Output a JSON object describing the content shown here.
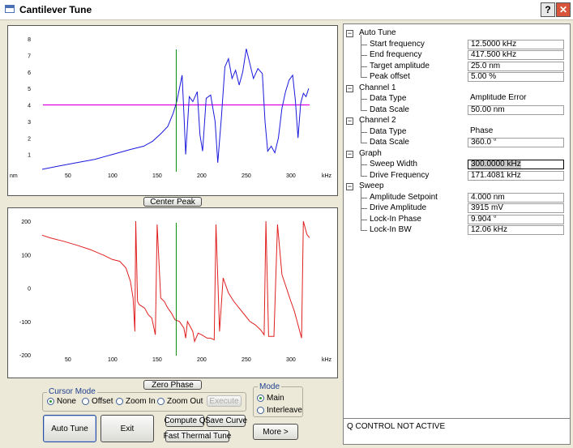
{
  "window": {
    "title": "Cantilever Tune",
    "help_label": "?",
    "close_label": "✕"
  },
  "buttons": {
    "center_peak": "Center Peak",
    "zero_phase": "Zero Phase",
    "execute": "Execute",
    "auto_tune": "Auto Tune",
    "exit": "Exit",
    "compute_q": "Compute Q",
    "save_curve": "Save Curve",
    "fast_thermal_tune": "Fast Thermal Tune",
    "more": "More >"
  },
  "cursor_mode": {
    "label": "Cursor Mode",
    "options": [
      "None",
      "Offset",
      "Zoom In",
      "Zoom Out"
    ],
    "selected": "None"
  },
  "mode": {
    "label": "Mode",
    "options": [
      "Main",
      "Interleave"
    ],
    "selected": "Main"
  },
  "settings": {
    "sections": [
      {
        "name": "Auto Tune",
        "items": [
          {
            "label": "Start frequency",
            "value": "12.5000 kHz",
            "boxed": true
          },
          {
            "label": "End frequency",
            "value": "417.500 kHz",
            "boxed": true
          },
          {
            "label": "Target amplitude",
            "value": "25.0 nm",
            "boxed": true
          },
          {
            "label": "Peak offset",
            "value": "5.00 %",
            "boxed": true
          }
        ]
      },
      {
        "name": "Channel 1",
        "items": [
          {
            "label": "Data Type",
            "value": "Amplitude Error",
            "boxed": false
          },
          {
            "label": "Data Scale",
            "value": "50.00 nm",
            "boxed": true
          }
        ]
      },
      {
        "name": "Channel 2",
        "items": [
          {
            "label": "Data Type",
            "value": "Phase",
            "boxed": false
          },
          {
            "label": "Data Scale",
            "value": "360.0 °",
            "boxed": true
          }
        ]
      },
      {
        "name": "Graph",
        "items": [
          {
            "label": "Sweep Width",
            "value": "300.0000 kHz",
            "boxed": true,
            "selected": true
          },
          {
            "label": "Drive Frequency",
            "value": "171.4081 kHz",
            "boxed": true
          }
        ]
      },
      {
        "name": "Sweep",
        "items": [
          {
            "label": "Amplitude Setpoint",
            "value": "4.000 nm",
            "boxed": true
          },
          {
            "label": "Drive Amplitude",
            "value": "3915 mV",
            "boxed": true
          },
          {
            "label": "Lock-In Phase",
            "value": "9.904 °",
            "boxed": true
          },
          {
            "label": "Lock-In BW",
            "value": "12.06 kHz",
            "boxed": true
          }
        ]
      }
    ]
  },
  "status": "Q CONTROL NOT ACTIVE",
  "colors": {
    "amplitude_trace": "#1a1adc",
    "phase_trace": "#e02020",
    "setpoint_line": "#e000e0",
    "drive_marker": "#0a8a0a"
  },
  "chart_data": [
    {
      "type": "line",
      "title": "",
      "xlabel": "kHz",
      "ylabel": "nm",
      "xlim": [
        21,
        321
      ],
      "ylim": [
        0,
        8
      ],
      "x_ticks": [
        50,
        100,
        150,
        200,
        250,
        300
      ],
      "y_ticks": [
        1,
        2,
        3,
        4,
        5,
        6,
        7,
        8
      ],
      "series": [
        {
          "values_xy": [
            [
              21,
              0.1
            ],
            [
              40,
              0.3
            ],
            [
              60,
              0.5
            ],
            [
              80,
              0.7
            ],
            [
              100,
              1.0
            ],
            [
              120,
              1.3
            ],
            [
              135,
              1.5
            ],
            [
              145,
              1.8
            ],
            [
              155,
              2.3
            ],
            [
              162,
              2.7
            ],
            [
              168,
              3.5
            ],
            [
              172,
              4.2
            ],
            [
              175,
              5.0
            ],
            [
              178,
              5.8
            ],
            [
              180,
              3.5
            ],
            [
              182,
              1.0
            ],
            [
              186,
              4.5
            ],
            [
              190,
              4.2
            ],
            [
              195,
              4.8
            ],
            [
              198,
              2.2
            ],
            [
              201,
              1.2
            ],
            [
              205,
              4.4
            ],
            [
              210,
              4.6
            ],
            [
              215,
              3.0
            ],
            [
              218,
              0.5
            ],
            [
              222,
              3.2
            ],
            [
              226,
              6.3
            ],
            [
              230,
              6.8
            ],
            [
              234,
              5.6
            ],
            [
              238,
              6.1
            ],
            [
              242,
              5.2
            ],
            [
              246,
              6.0
            ],
            [
              250,
              7.4
            ],
            [
              254,
              6.5
            ],
            [
              258,
              5.6
            ],
            [
              263,
              6.2
            ],
            [
              268,
              5.9
            ],
            [
              271,
              3.0
            ],
            [
              274,
              1.2
            ],
            [
              278,
              1.5
            ],
            [
              282,
              1.1
            ],
            [
              286,
              2.0
            ],
            [
              290,
              3.8
            ],
            [
              294,
              4.8
            ],
            [
              298,
              5.5
            ],
            [
              302,
              5.8
            ],
            [
              305,
              4.3
            ],
            [
              308,
              2.0
            ],
            [
              311,
              4.1
            ],
            [
              314,
              4.7
            ],
            [
              317,
              4.5
            ],
            [
              320,
              5.0
            ]
          ]
        }
      ],
      "setpoint": 4.0,
      "drive_frequency": 171.4
    },
    {
      "type": "line",
      "title": "",
      "xlabel": "kHz",
      "ylabel": "",
      "xlim": [
        21,
        321
      ],
      "ylim": [
        -200,
        200
      ],
      "x_ticks": [
        50,
        100,
        150,
        200,
        250,
        300
      ],
      "y_ticks": [
        200,
        100,
        0,
        -100,
        -200
      ],
      "series": [
        {
          "values_xy": [
            [
              21,
              158
            ],
            [
              30,
              150
            ],
            [
              45,
              140
            ],
            [
              60,
              128
            ],
            [
              75,
              115
            ],
            [
              90,
              98
            ],
            [
              100,
              85
            ],
            [
              108,
              80
            ],
            [
              115,
              60
            ],
            [
              120,
              20
            ],
            [
              123,
              -30
            ],
            [
              125,
              -130
            ],
            [
              126,
              200
            ],
            [
              128,
              -40
            ],
            [
              130,
              -50
            ],
            [
              136,
              -60
            ],
            [
              140,
              -80
            ],
            [
              144,
              -90
            ],
            [
              148,
              -140
            ],
            [
              150,
              190
            ],
            [
              154,
              -30
            ],
            [
              158,
              -40
            ],
            [
              162,
              -60
            ],
            [
              166,
              -75
            ],
            [
              170,
              -95
            ],
            [
              175,
              -100
            ],
            [
              180,
              -120
            ],
            [
              182,
              -150
            ],
            [
              184,
              -100
            ],
            [
              186,
              -110
            ],
            [
              190,
              -130
            ],
            [
              192,
              -160
            ],
            [
              196,
              -135
            ],
            [
              200,
              -140
            ],
            [
              206,
              -150
            ],
            [
              210,
              -150
            ],
            [
              214,
              -155
            ],
            [
              216,
              190
            ],
            [
              220,
              -130
            ],
            [
              224,
              30
            ],
            [
              230,
              -15
            ],
            [
              236,
              -40
            ],
            [
              242,
              -60
            ],
            [
              248,
              -80
            ],
            [
              254,
              -100
            ],
            [
              260,
              -110
            ],
            [
              266,
              -125
            ],
            [
              270,
              -140
            ],
            [
              272,
              200
            ],
            [
              275,
              -145
            ],
            [
              281,
              -145
            ],
            [
              285,
              190
            ],
            [
              290,
              40
            ],
            [
              295,
              0
            ],
            [
              300,
              -40
            ],
            [
              304,
              -70
            ],
            [
              308,
              -110
            ],
            [
              312,
              -150
            ],
            [
              314,
              200
            ],
            [
              318,
              160
            ],
            [
              321,
              150
            ]
          ]
        }
      ],
      "drive_frequency": 171.4
    }
  ]
}
